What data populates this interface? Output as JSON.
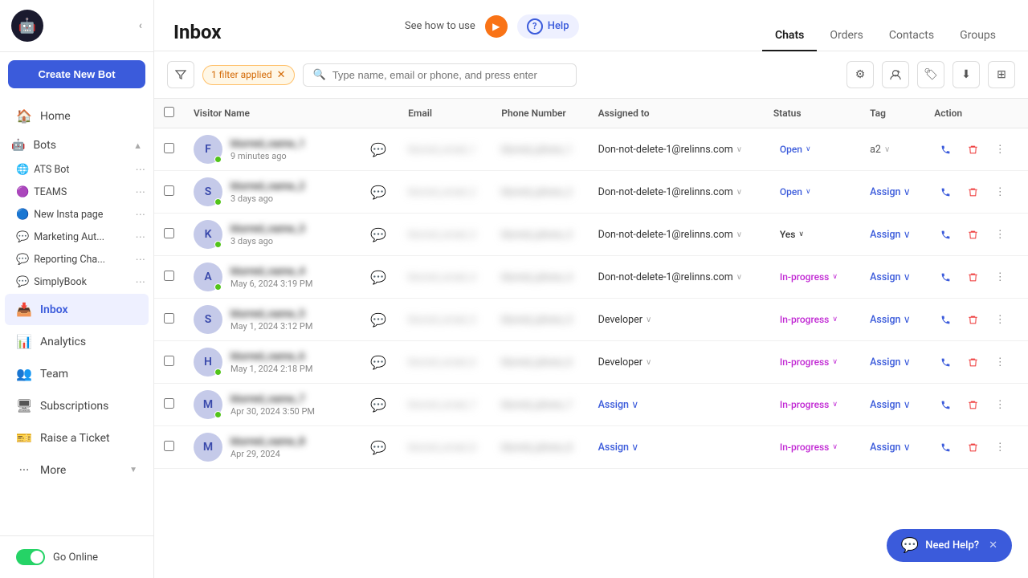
{
  "sidebar": {
    "logo_text": "🤖",
    "create_bot_label": "Create New Bot",
    "collapse_icon": "‹",
    "nav_items": [
      {
        "id": "home",
        "label": "Home",
        "icon": "🏠"
      },
      {
        "id": "bots",
        "label": "Bots",
        "icon": "🤖",
        "expanded": true
      },
      {
        "id": "inbox",
        "label": "Inbox",
        "icon": "📥",
        "active": true
      },
      {
        "id": "analytics",
        "label": "Analytics",
        "icon": "📊"
      },
      {
        "id": "team",
        "label": "Team",
        "icon": "👥"
      },
      {
        "id": "subscriptions",
        "label": "Subscriptions",
        "icon": "🖥"
      },
      {
        "id": "raise-ticket",
        "label": "Raise a Ticket",
        "icon": "🎫"
      },
      {
        "id": "more",
        "label": "More",
        "icon": "···"
      }
    ],
    "bots": [
      {
        "name": "ATS Bot",
        "icon_type": "globe"
      },
      {
        "name": "TEAMS",
        "icon_type": "teams"
      },
      {
        "name": "New Insta page",
        "icon_type": "fb"
      },
      {
        "name": "Marketing Aut...",
        "icon_type": "wa"
      },
      {
        "name": "Reporting Cha...",
        "icon_type": "wa"
      },
      {
        "name": "SimplyBook",
        "icon_type": "wa"
      }
    ],
    "go_online_label": "Go Online"
  },
  "header": {
    "title": "Inbox",
    "see_how_label": "See how to use",
    "help_label": "Help",
    "play_icon": "▶"
  },
  "tabs": [
    {
      "id": "chats",
      "label": "Chats",
      "active": true
    },
    {
      "id": "orders",
      "label": "Orders"
    },
    {
      "id": "contacts",
      "label": "Contacts"
    },
    {
      "id": "groups",
      "label": "Groups"
    }
  ],
  "toolbar": {
    "filter_icon": "⊞",
    "filter_badge": "1 filter applied",
    "filter_close_icon": "✕",
    "search_placeholder": "Type name, email or phone, and press enter",
    "icon_buttons": [
      "⚙",
      "👤+",
      "🏷",
      "⬇",
      "⊞"
    ]
  },
  "table": {
    "columns": [
      "",
      "Visitor Name",
      "",
      "Email",
      "Phone Number",
      "Assigned to",
      "Status",
      "Tag",
      "Action"
    ],
    "rows": [
      {
        "avatar": "F",
        "avatar_color": "#c5cae9",
        "avatar_text_color": "#3949ab",
        "online": true,
        "name": "blurred_name_1",
        "time": "9 minutes ago",
        "email": "blurred_email_1",
        "phone": "blurred_phone_1",
        "assigned_to": "Don-not-delete-1@relinns.com",
        "status": "Open",
        "status_type": "open",
        "tag": "a2",
        "tag_type": "tag"
      },
      {
        "avatar": "S",
        "avatar_color": "#c5cae9",
        "avatar_text_color": "#3949ab",
        "online": true,
        "name": "blurred_name_2",
        "time": "3 days ago",
        "email": "blurred_email_2",
        "phone": "blurred_phone_2",
        "assigned_to": "Don-not-delete-1@relinns.com",
        "status": "Open",
        "status_type": "open",
        "tag": "Assign",
        "tag_type": "assign"
      },
      {
        "avatar": "K",
        "avatar_color": "#c5cae9",
        "avatar_text_color": "#3949ab",
        "online": true,
        "name": "blurred_name_3",
        "time": "3 days ago",
        "email": "blurred_email_3",
        "phone": "blurred_phone_3",
        "assigned_to": "Don-not-delete-1@relinns.com",
        "status": "Yes",
        "status_type": "yes",
        "tag": "Assign",
        "tag_type": "assign"
      },
      {
        "avatar": "A",
        "avatar_color": "#c5cae9",
        "avatar_text_color": "#3949ab",
        "online": true,
        "name": "blurred_name_4",
        "time": "May 6, 2024 3:19 PM",
        "email": "blurred_email_4",
        "phone": "blurred_phone_4",
        "assigned_to": "Don-not-delete-1@relinns.com",
        "status": "In-progress",
        "status_type": "in-progress",
        "tag": "Assign",
        "tag_type": "assign"
      },
      {
        "avatar": "S",
        "avatar_color": "#c5cae9",
        "avatar_text_color": "#3949ab",
        "online": false,
        "name": "blurred_name_5",
        "time": "May 1, 2024 3:12 PM",
        "email": "blurred_email_5",
        "phone": "blurred_phone_5",
        "assigned_to": "Developer",
        "status": "In-progress",
        "status_type": "in-progress",
        "tag": "Assign",
        "tag_type": "assign"
      },
      {
        "avatar": "H",
        "avatar_color": "#c5cae9",
        "avatar_text_color": "#3949ab",
        "online": true,
        "name": "blurred_name_6",
        "time": "May 1, 2024 2:18 PM",
        "email": "blurred_email_6",
        "phone": "blurred_phone_6",
        "assigned_to": "Developer",
        "status": "In-progress",
        "status_type": "in-progress",
        "tag": "Assign",
        "tag_type": "assign"
      },
      {
        "avatar": "M",
        "avatar_color": "#c5cae9",
        "avatar_text_color": "#3949ab",
        "online": true,
        "name": "blurred_name_7",
        "time": "Apr 30, 2024 3:50 PM",
        "email": "blurred_email_7",
        "phone": "blurred_phone_7",
        "assigned_to": "Assign",
        "assigned_type": "assign",
        "status": "In-progress",
        "status_type": "in-progress",
        "tag": "Assign",
        "tag_type": "assign"
      },
      {
        "avatar": "M",
        "avatar_color": "#c5cae9",
        "avatar_text_color": "#3949ab",
        "online": false,
        "name": "blurred_name_8",
        "time": "Apr 29, 2024",
        "email": "blurred_email_8",
        "phone": "blurred_phone_8",
        "assigned_to": "Assign",
        "assigned_type": "assign",
        "status": "In-progress",
        "status_type": "in-progress",
        "tag": "Assign",
        "tag_type": "assign"
      }
    ]
  },
  "help_bubble": {
    "label": "Need Help?",
    "icon": "💬",
    "close": "✕"
  }
}
